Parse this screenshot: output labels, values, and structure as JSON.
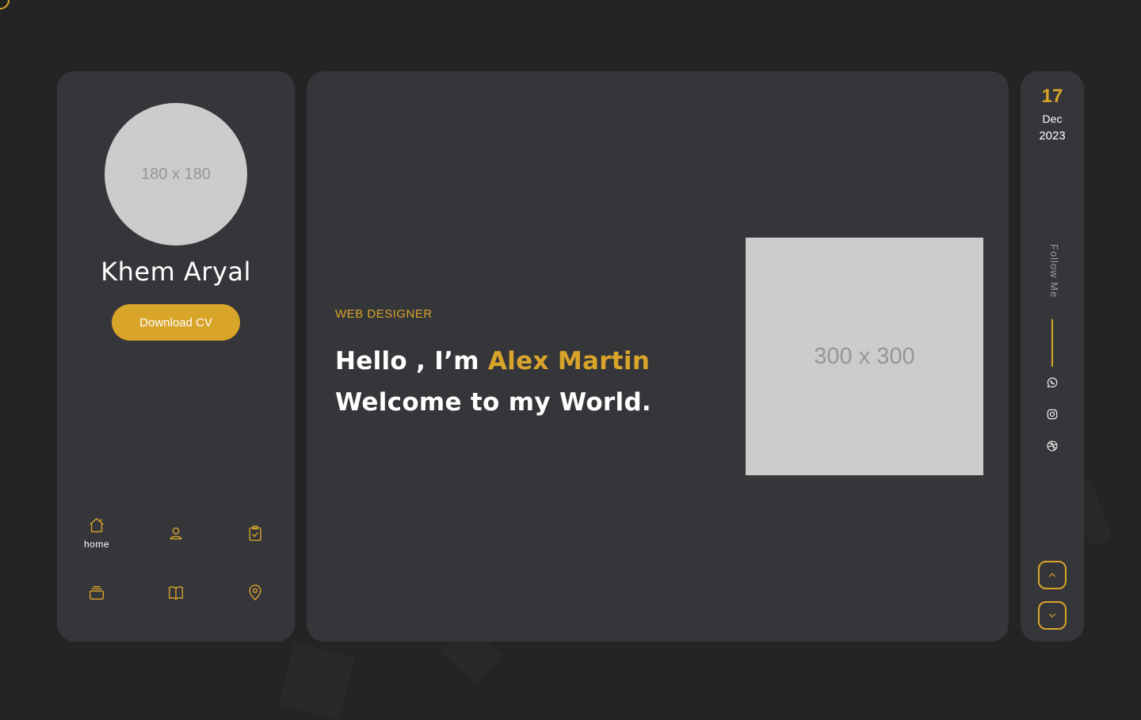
{
  "colors": {
    "background": "#242424",
    "panel": "#35363a",
    "accent": "#D9A42A",
    "text": "#ffffff",
    "placeholder": "#cccccc",
    "muted": "#9a9a9a"
  },
  "profile": {
    "avatar_placeholder": "180 x 180",
    "name": "Khem Aryal",
    "download_label": "Download CV"
  },
  "nav": {
    "items": [
      {
        "icon": "home-icon",
        "label": "home"
      },
      {
        "icon": "user-icon",
        "label": ""
      },
      {
        "icon": "clipboard-check-icon",
        "label": ""
      },
      {
        "icon": "stack-icon",
        "label": ""
      },
      {
        "icon": "book-icon",
        "label": ""
      },
      {
        "icon": "map-pin-icon",
        "label": ""
      }
    ]
  },
  "hero": {
    "role": "WEB DESIGNER",
    "greeting": "Hello , I’m ",
    "name": "Alex Martin",
    "tagline": "Welcome to my World.",
    "image_placeholder": "300 x 300"
  },
  "sidebar_right": {
    "day": "17",
    "month": "Dec",
    "year": "2023",
    "follow_label": "Follow Me",
    "social": [
      "whatsapp-icon",
      "instagram-icon",
      "dribbble-icon"
    ],
    "scroll_icons": [
      "chevron-up-icon",
      "chevron-down-icon"
    ]
  }
}
